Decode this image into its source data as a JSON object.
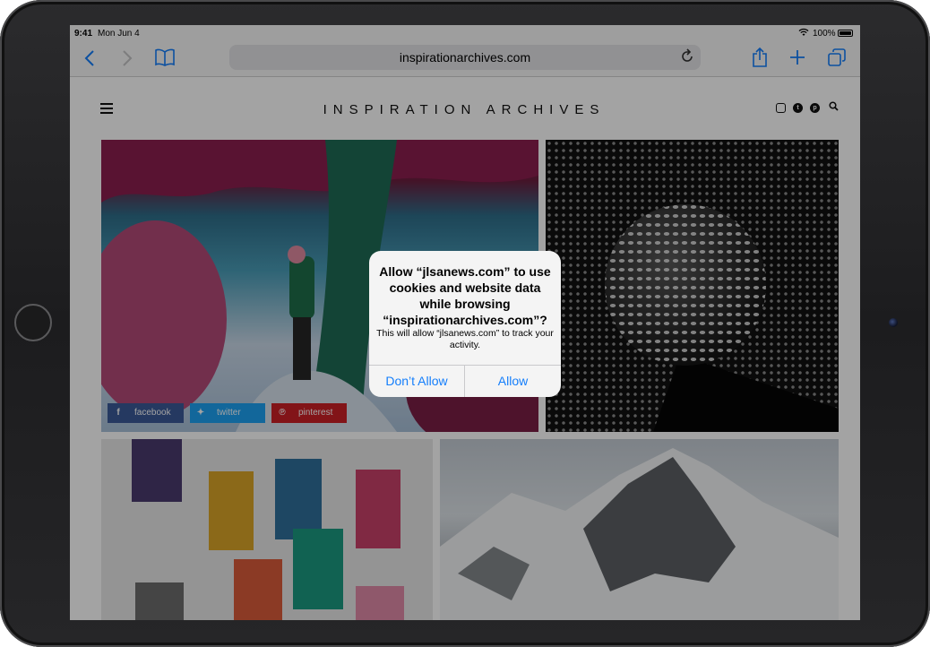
{
  "status": {
    "time": "9:41",
    "date": "Mon Jun 4",
    "battery": "100%"
  },
  "browser": {
    "url": "inspirationarchives.com"
  },
  "site": {
    "title": "INSPIRATION ARCHIVES"
  },
  "share": {
    "facebook": "facebook",
    "twitter": "twitter",
    "pinterest": "pinterest"
  },
  "dialog": {
    "title": "Allow “jlsanews.com” to use cookies and website data while browsing “inspirationarchives.com”?",
    "message": "This will allow “jlsanews.com” to track your activity.",
    "deny_label": "Don’t Allow",
    "allow_label": "Allow"
  },
  "colors": {
    "accent": "#147efb",
    "facebook": "#3b5998",
    "twitter": "#1da1f2",
    "pinterest": "#cb2027"
  }
}
